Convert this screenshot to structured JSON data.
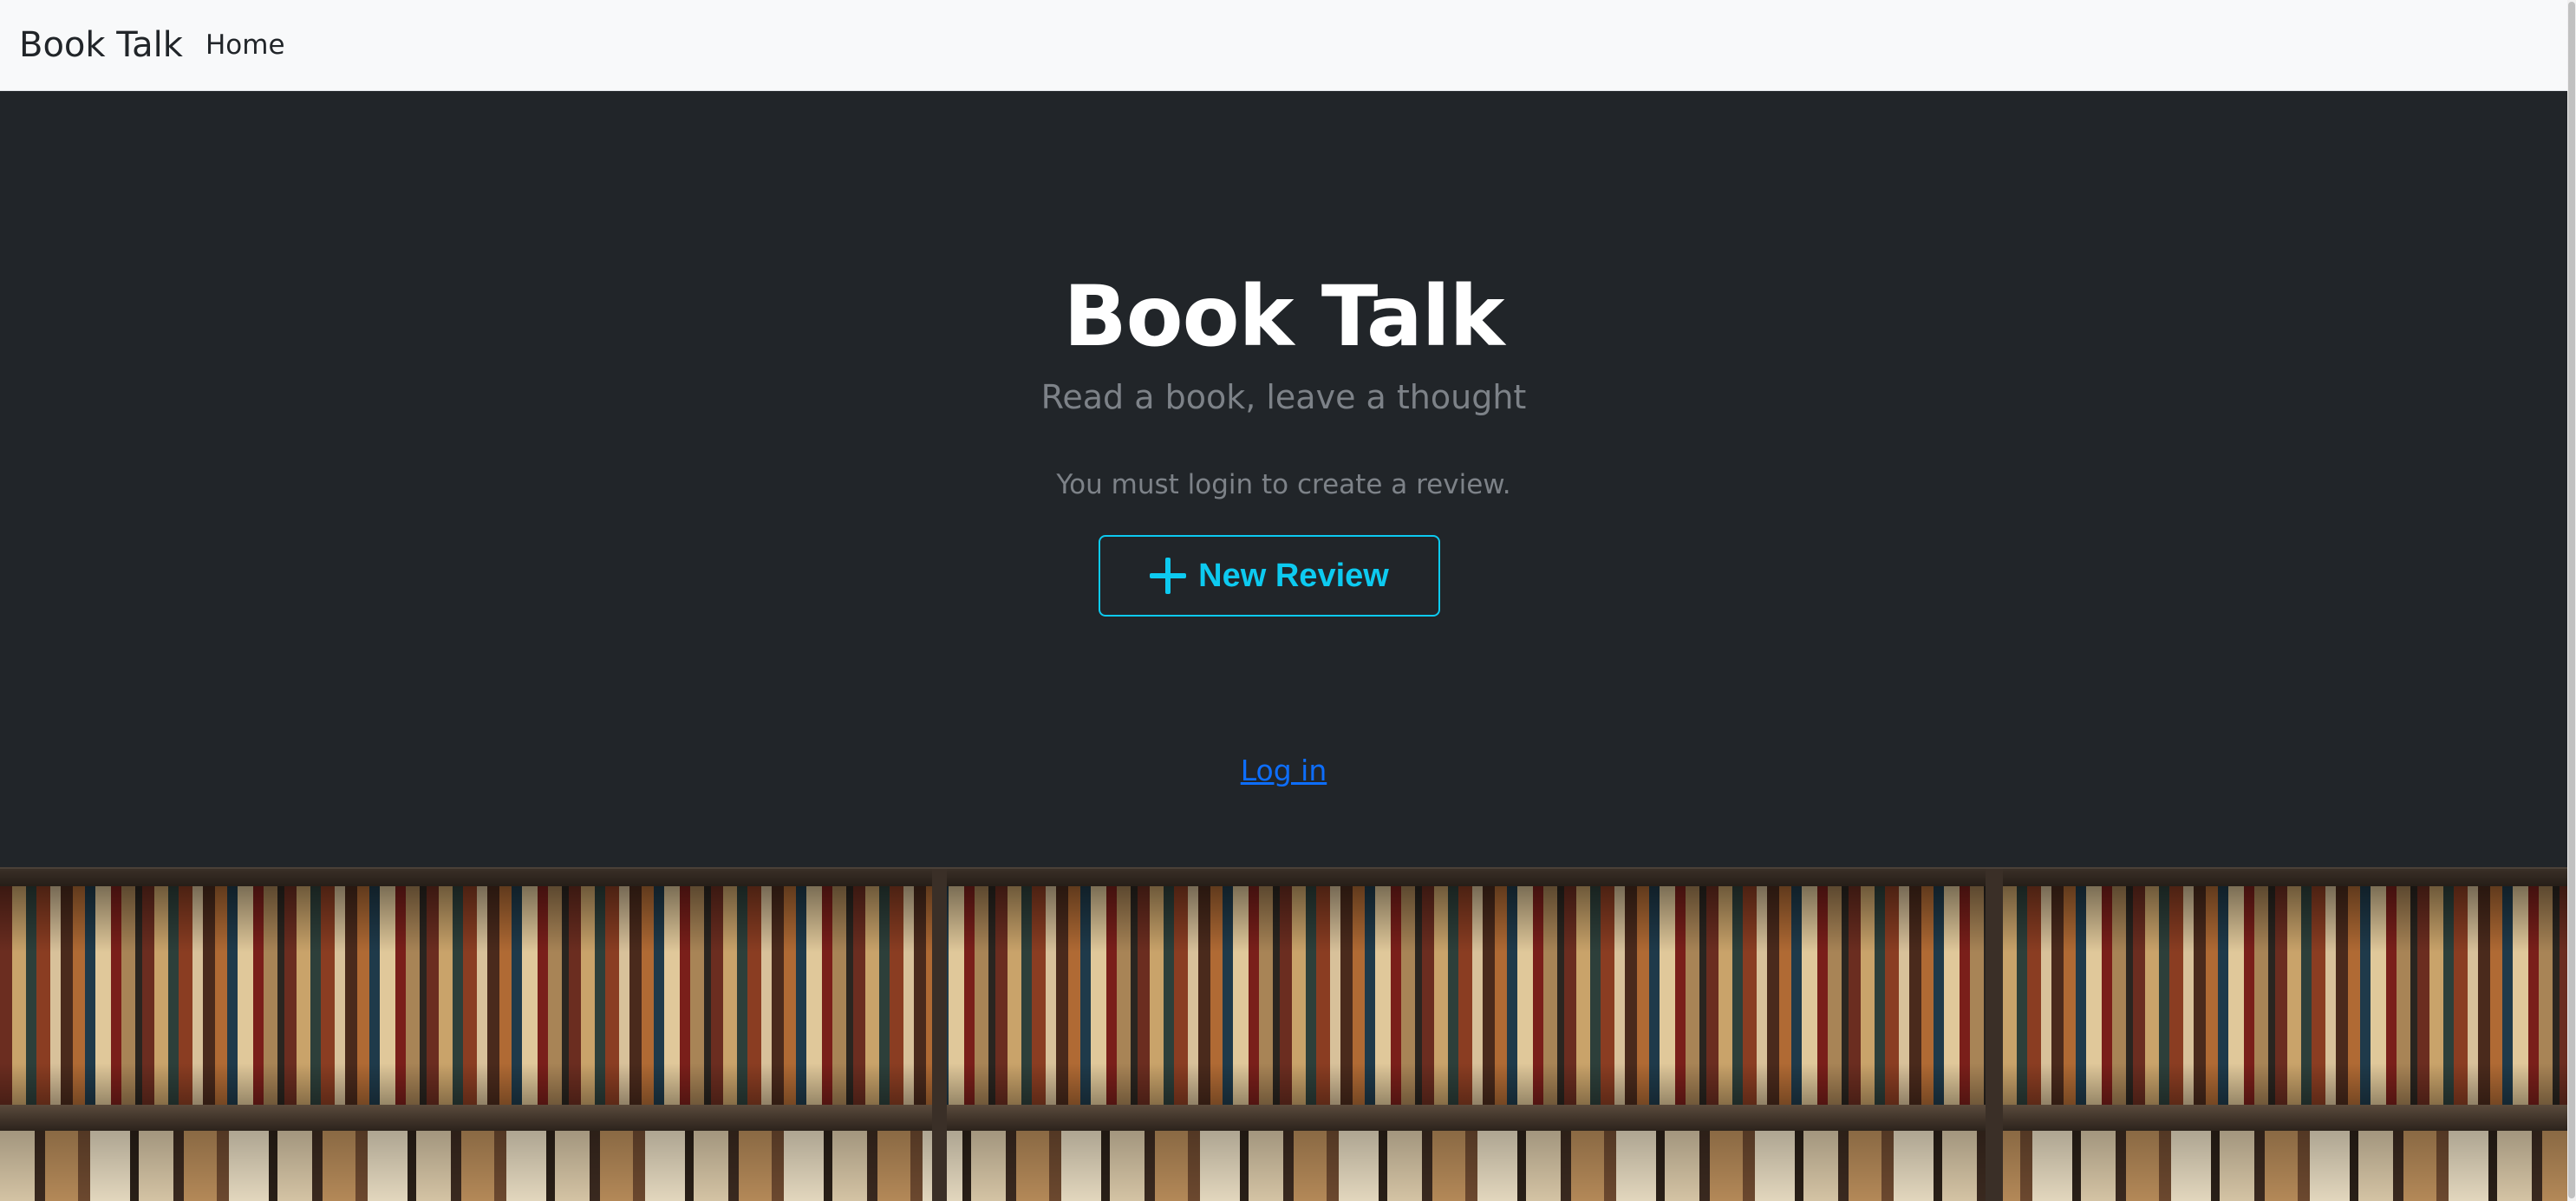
{
  "navbar": {
    "brand": "Book Talk",
    "home_label": "Home"
  },
  "hero": {
    "title": "Book Talk",
    "subtitle": "Read a book, leave a thought",
    "login_notice": "You must login to create a review.",
    "new_review_label": "New Review",
    "new_review_icon": "plus-icon",
    "login_link": "Log in"
  },
  "colors": {
    "navbar_bg": "#f8f9fa",
    "hero_bg": "#212529",
    "accent_info": "#0dcaf0",
    "link_blue": "#0d6efd",
    "muted_text": "#7d8288"
  }
}
